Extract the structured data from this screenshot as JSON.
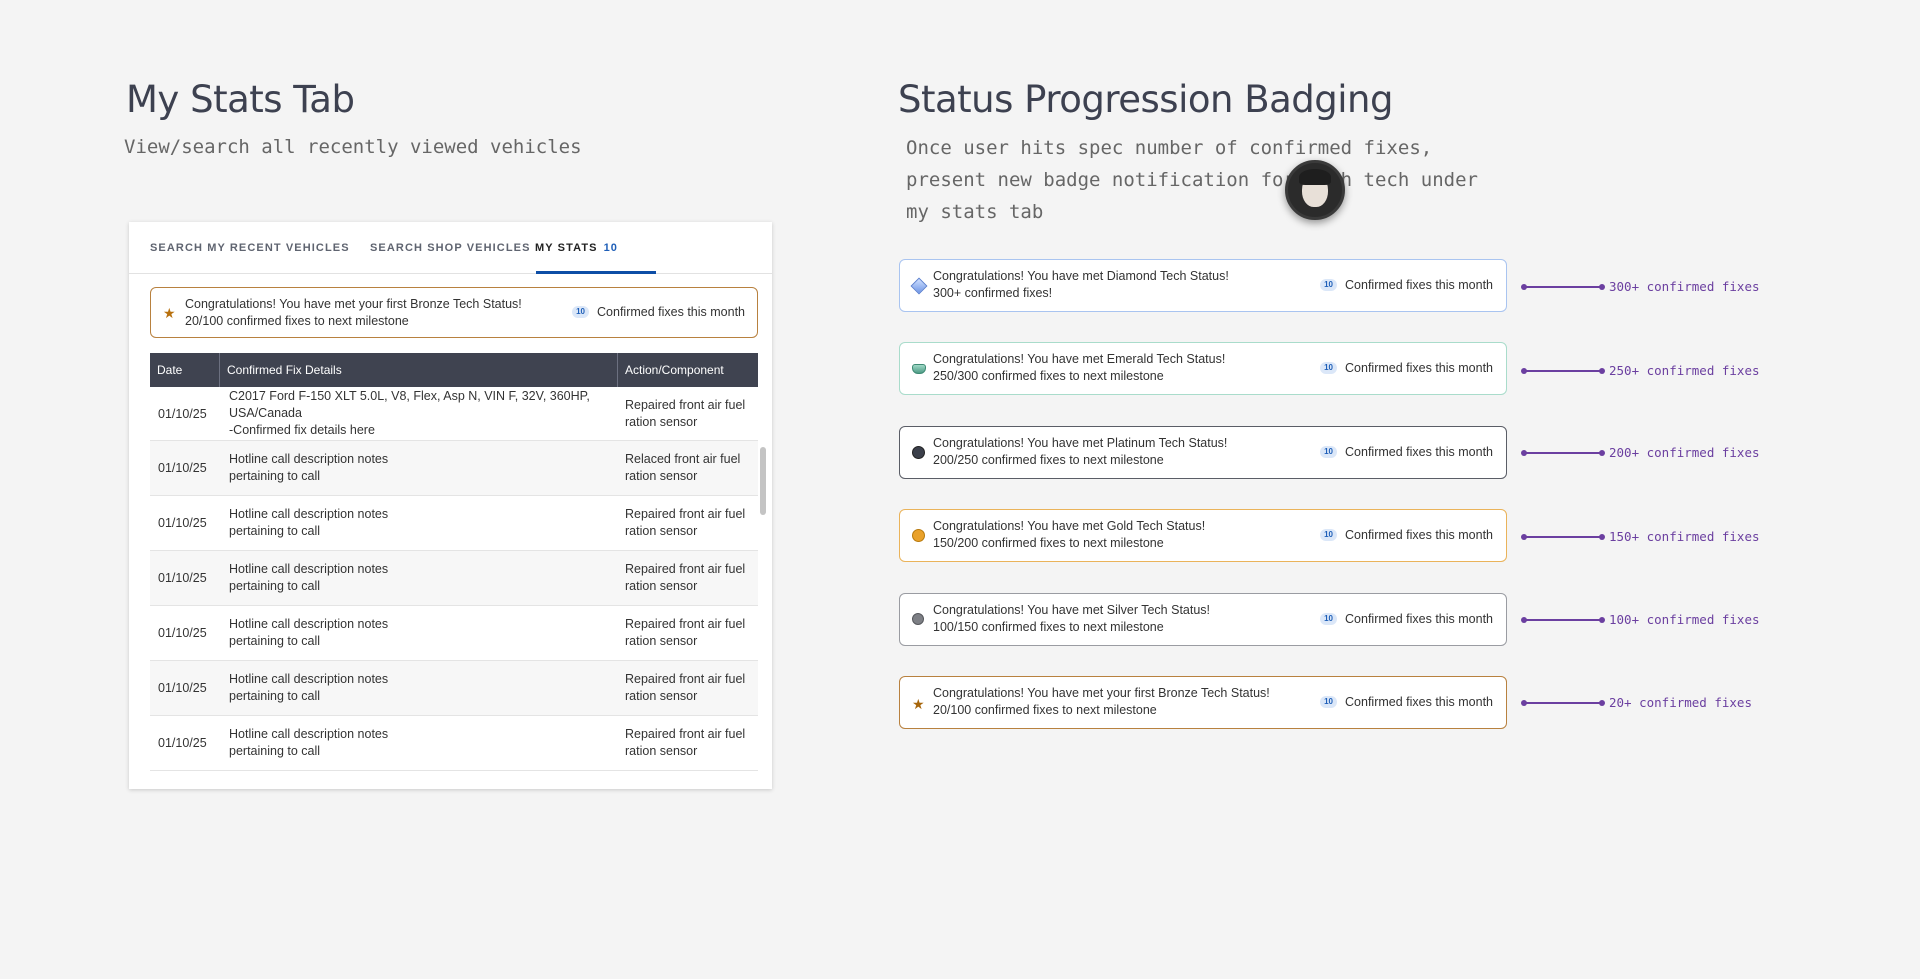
{
  "left": {
    "title": "My Stats Tab",
    "subtitle": "View/search all recently viewed vehicles"
  },
  "tabs": [
    {
      "label": "SEARCH MY RECENT VEHICLES"
    },
    {
      "label": "SEARCH SHOP VEHICLES"
    },
    {
      "label": "MY STATS",
      "count": "10"
    }
  ],
  "top_alert": {
    "line1": "Congratulations! You have met your first Bronze Tech Status!",
    "line2": "20/100 confirmed fixes to next milestone",
    "pill": "10",
    "right_label": "Confirmed fixes this month",
    "icon": "star-icon"
  },
  "table": {
    "headers": [
      "Date",
      "Confirmed Fix Details",
      "Action/Component"
    ],
    "rows": [
      {
        "date": "01/10/25",
        "details": "C2017 Ford F-150 XLT 5.0L, V8, Flex, Asp N, VIN F, 32V, 360HP, USA/Canada\n-Confirmed fix details here",
        "action": "Repaired front air fuel ration sensor"
      },
      {
        "date": "01/10/25",
        "details": "Hotline call description notes\npertaining to call",
        "action": "Relaced front air fuel ration sensor"
      },
      {
        "date": "01/10/25",
        "details": "Hotline call description notes\npertaining to call",
        "action": "Repaired front air fuel ration sensor"
      },
      {
        "date": "01/10/25",
        "details": "Hotline call description notes\npertaining to call",
        "action": "Repaired front air fuel ration sensor"
      },
      {
        "date": "01/10/25",
        "details": "Hotline call description notes\npertaining to call",
        "action": "Repaired front air fuel ration sensor"
      },
      {
        "date": "01/10/25",
        "details": "Hotline call description notes\npertaining to call",
        "action": "Repaired front air fuel ration sensor"
      },
      {
        "date": "01/10/25",
        "details": "Hotline call description notes\npertaining to call",
        "action": "Repaired front air fuel ration sensor"
      }
    ]
  },
  "right": {
    "title": "Status Progression Badging",
    "description": "Once user hits spec number of confirmed fixes, present new badge notification for each tech under my stats tab"
  },
  "badges": [
    {
      "line1": "Congratulations! You have met Diamond Tech Status!",
      "line2": "300+ confirmed fixes!",
      "pill": "10",
      "right_label": "Confirmed fixes this month",
      "connector_label": "300+ confirmed fixes",
      "border_color": "#a9c4f0",
      "icon": "diamond-icon"
    },
    {
      "line1": "Congratulations! You have met Emerald Tech Status!",
      "line2": "250/300 confirmed fixes to next milestone",
      "pill": "10",
      "right_label": "Confirmed fixes this month",
      "connector_label": "250+ confirmed fixes",
      "border_color": "#a9dccb",
      "icon": "emerald-icon"
    },
    {
      "line1": "Congratulations! You have met Platinum Tech Status!",
      "line2": "200/250 confirmed fixes to next milestone",
      "pill": "10",
      "right_label": "Confirmed fixes this month",
      "connector_label": "200+ confirmed fixes",
      "border_color": "#5a5d66",
      "icon": "platinum-icon"
    },
    {
      "line1": "Congratulations! You have met Gold Tech Status!",
      "line2": "150/200 confirmed fixes to next milestone",
      "pill": "10",
      "right_label": "Confirmed fixes this month",
      "connector_label": "150+ confirmed fixes",
      "border_color": "#eab35a",
      "icon": "gold-icon"
    },
    {
      "line1": "Congratulations! You have met Silver Tech Status!",
      "line2": "100/150 confirmed fixes to next milestone",
      "pill": "10",
      "right_label": "Confirmed fixes this month",
      "connector_label": "100+ confirmed fixes",
      "border_color": "#9a9ca2",
      "icon": "silver-icon"
    },
    {
      "line1": "Congratulations! You have met your first Bronze Tech Status!",
      "line2": "20/100 confirmed fixes to next milestone",
      "pill": "10",
      "right_label": "Confirmed fixes this month",
      "connector_label": "20+ confirmed fixes",
      "border_color": "#b8813f",
      "icon": "star-icon"
    }
  ],
  "colors": {
    "accent_blue": "#0d4ea6",
    "connector_purple": "#6b3fa0",
    "table_header": "#3f4350"
  }
}
